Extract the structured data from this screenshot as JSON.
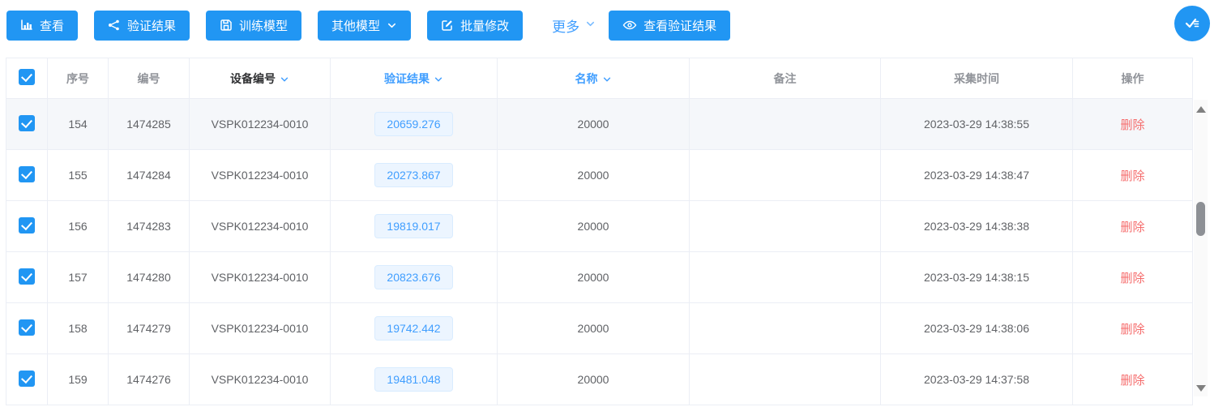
{
  "colors": {
    "button_blue": "#2196f3",
    "accent_blue": "#409eff",
    "tag_bg": "#ecf5ff",
    "tag_border": "#d9ecff",
    "delete_red": "#f56c6c",
    "row_highlight": "#f5f7fa",
    "table_border": "#ebeef5"
  },
  "toolbar": {
    "view_label": "查看",
    "verify_label": "验证结果",
    "train_label": "训练模型",
    "other_models_label": "其他模型",
    "batch_edit_label": "批量修改",
    "more_label": "更多",
    "view_verify_results_label": "查看验证结果"
  },
  "table": {
    "columns": [
      {
        "label": "序号"
      },
      {
        "label": "编号"
      },
      {
        "label": "设备编号",
        "sortable": true
      },
      {
        "label": "验证结果",
        "sortable": true
      },
      {
        "label": "名称",
        "sortable": true
      },
      {
        "label": "备注"
      },
      {
        "label": "采集时间"
      },
      {
        "label": "操作"
      }
    ],
    "header_checkbox_checked": true,
    "rows": [
      {
        "checked": true,
        "seq": "154",
        "code": "1474285",
        "device": "VSPK012234-0010",
        "result": "20659.276",
        "name": "20000",
        "remark": "",
        "time": "2023-03-29 14:38:55",
        "action": "删除",
        "highlighted": true
      },
      {
        "checked": true,
        "seq": "155",
        "code": "1474284",
        "device": "VSPK012234-0010",
        "result": "20273.867",
        "name": "20000",
        "remark": "",
        "time": "2023-03-29 14:38:47",
        "action": "删除",
        "highlighted": false
      },
      {
        "checked": true,
        "seq": "156",
        "code": "1474283",
        "device": "VSPK012234-0010",
        "result": "19819.017",
        "name": "20000",
        "remark": "",
        "time": "2023-03-29 14:38:38",
        "action": "删除",
        "highlighted": false
      },
      {
        "checked": true,
        "seq": "157",
        "code": "1474280",
        "device": "VSPK012234-0010",
        "result": "20823.676",
        "name": "20000",
        "remark": "",
        "time": "2023-03-29 14:38:15",
        "action": "删除",
        "highlighted": false
      },
      {
        "checked": true,
        "seq": "158",
        "code": "1474279",
        "device": "VSPK012234-0010",
        "result": "19742.442",
        "name": "20000",
        "remark": "",
        "time": "2023-03-29 14:38:06",
        "action": "删除",
        "highlighted": false
      },
      {
        "checked": true,
        "seq": "159",
        "code": "1474276",
        "device": "VSPK012234-0010",
        "result": "19481.048",
        "name": "20000",
        "remark": "",
        "time": "2023-03-29 14:37:58",
        "action": "删除",
        "highlighted": false
      }
    ]
  }
}
